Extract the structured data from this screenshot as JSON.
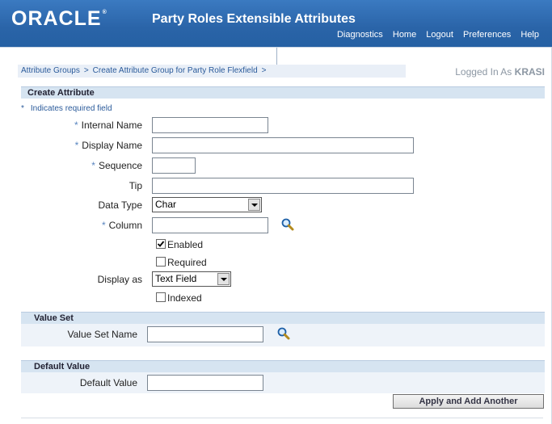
{
  "header": {
    "logo": "ORACLE",
    "logo_mark": "®",
    "app_title": "Party Roles Extensible Attributes",
    "links": [
      "Diagnostics",
      "Home",
      "Logout",
      "Preferences",
      "Help"
    ]
  },
  "breadcrumb": {
    "item1": "Attribute Groups",
    "item2": "Create Attribute Group for Party Role Flexfield",
    "sep": ">"
  },
  "user": {
    "prefix": "Logged In As",
    "name": "KRASI"
  },
  "create_attribute": {
    "title": "Create Attribute",
    "required_note_star": "*",
    "required_note": "Indicates required field",
    "internal_name_label": "Internal Name",
    "display_name_label": "Display Name",
    "sequence_label": "Sequence",
    "tip_label": "Tip",
    "data_type_label": "Data Type",
    "data_type_value": "Char",
    "column_label": "Column",
    "enabled_label": "Enabled",
    "enabled_checked": true,
    "required_label": "Required",
    "required_checked": false,
    "display_as_label": "Display as",
    "display_as_value": "Text Field",
    "indexed_label": "Indexed",
    "indexed_checked": false,
    "star": "*"
  },
  "value_set": {
    "title": "Value Set",
    "name_label": "Value Set Name"
  },
  "default_value": {
    "title": "Default Value",
    "label": "Default Value"
  },
  "actions": {
    "apply_add_another": "Apply and Add Another"
  },
  "icons": {
    "lov": "magnifier-icon",
    "checkmark": "check-icon"
  },
  "colors": {
    "header_blue": "#2a64a8",
    "section_bg": "#d6e4f1",
    "link_blue": "#2a5a9a"
  }
}
